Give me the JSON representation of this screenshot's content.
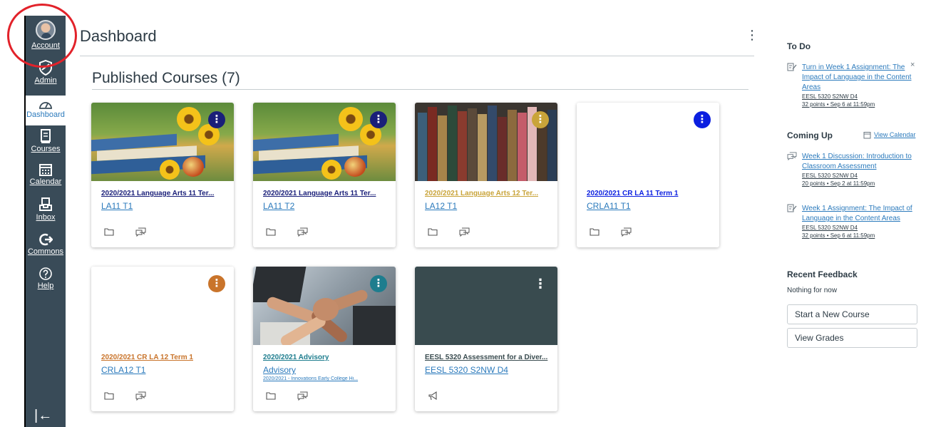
{
  "nav": {
    "items": [
      {
        "key": "account",
        "label": "Account",
        "icon": "user-avatar-icon"
      },
      {
        "key": "admin",
        "label": "Admin",
        "icon": "shield-icon"
      },
      {
        "key": "dashboard",
        "label": "Dashboard",
        "icon": "speedometer-icon",
        "active": true
      },
      {
        "key": "courses",
        "label": "Courses",
        "icon": "book-icon"
      },
      {
        "key": "calendar",
        "label": "Calendar",
        "icon": "calendar-icon"
      },
      {
        "key": "inbox",
        "label": "Inbox",
        "icon": "inbox-icon"
      },
      {
        "key": "commons",
        "label": "Commons",
        "icon": "commons-arrow-icon"
      },
      {
        "key": "help",
        "label": "Help",
        "icon": "question-icon"
      }
    ],
    "collapse_glyph": "|←"
  },
  "header": {
    "title": "Dashboard",
    "kebab_glyph": "⋮"
  },
  "section": {
    "title": "Published Courses (7)"
  },
  "cards": [
    {
      "title": "2020/2021 Language Arts 11 Ter...",
      "code": "LA11 T1",
      "term": "",
      "color": "#1a1f79",
      "hero": "books",
      "icons": [
        "folder-icon",
        "discussion-icon"
      ]
    },
    {
      "title": "2020/2021 Language Arts 11 Ter...",
      "code": "LA11 T2",
      "term": "",
      "color": "#1a1f79",
      "hero": "books",
      "icons": [
        "folder-icon",
        "discussion-icon"
      ]
    },
    {
      "title": "2020/2021 Language Arts 12 Ter...",
      "code": "LA12 T1",
      "term": "",
      "color": "#c9a43a",
      "hero": "library",
      "icons": [
        "folder-icon",
        "discussion-icon"
      ]
    },
    {
      "title": "2020/2021 CR LA 11 Term 1",
      "code": "CRLA11 T1",
      "term": "",
      "color": "#0b1fe0",
      "hero": "blank",
      "icons": [
        "folder-icon",
        "discussion-icon"
      ]
    },
    {
      "title": "2020/2021 CR LA 12 Term 1",
      "code": "CRLA12 T1",
      "term": "",
      "color": "#c9742b",
      "hero": "blank",
      "icons": [
        "folder-icon",
        "discussion-icon"
      ]
    },
    {
      "title": "2020/2021 Advisory",
      "code": "Advisory",
      "term": "2020/2021 - Innovations Early College Hi...",
      "color": "#1e7d8e",
      "hero": "hands",
      "icons": [
        "folder-icon",
        "discussion-icon"
      ]
    },
    {
      "title": "EESL 5320 Assessment for a Diver...",
      "code": "EESL 5320 S2NW D4",
      "term": "",
      "color": "#394b4f",
      "hero": "dark",
      "icons": [
        "announcement-icon"
      ]
    }
  ],
  "sidebar": {
    "todo_heading": "To Do",
    "todo_item": {
      "title": "Turn in Week 1 Assignment: The Impact of Language in the Content Areas",
      "course": "EESL 5320 S2NW D4",
      "meta": "32 points • Sep 6 at 11:59pm",
      "close_glyph": "×"
    },
    "coming_heading": "Coming Up",
    "view_calendar": "View Calendar",
    "coming_items": [
      {
        "title": "Week 1 Discussion: Introduction to Classroom Assessment",
        "course": "EESL 5320 S2NW D4",
        "meta": "20 points • Sep 2 at 11:59pm",
        "icon": "discussion-icon"
      },
      {
        "title": "Week 1 Assignment: The Impact of Language in the Content Areas",
        "course": "EESL 5320 S2NW D4",
        "meta": "32 points • Sep 6 at 11:59pm",
        "icon": "assignment-icon"
      }
    ],
    "feedback_heading": "Recent Feedback",
    "feedback_empty": "Nothing for now",
    "buttons": {
      "start_course": "Start a New Course",
      "view_grades": "View Grades"
    }
  },
  "colors": {
    "nav_bg": "#394b58",
    "link": "#2b7abc",
    "highlight": "#e2222a"
  }
}
